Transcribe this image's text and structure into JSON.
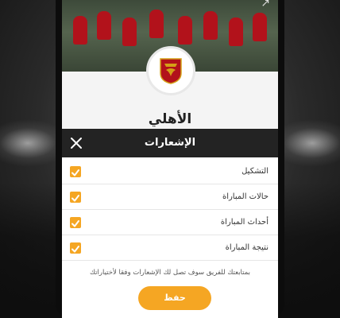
{
  "club": {
    "name": "الأهلي"
  },
  "notifications_modal": {
    "title": "الإشعارات",
    "options": [
      {
        "label": "التشكيل",
        "checked": true
      },
      {
        "label": "حالات المباراة",
        "checked": true
      },
      {
        "label": "أحداث المباراة",
        "checked": true
      },
      {
        "label": "نتيجة المباراة",
        "checked": true
      }
    ],
    "hint": "بمتابعتك للفريق سوف تصل لك الإشعارات وفقا لأختياراتك",
    "save_label": "حفظ"
  },
  "colors": {
    "accent": "#f5a623",
    "header_bg": "#232323",
    "club_red": "#b2121b"
  }
}
